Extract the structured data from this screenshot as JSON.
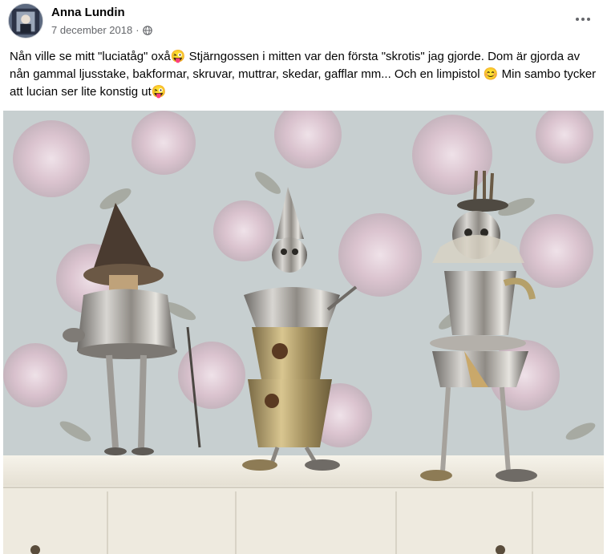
{
  "post": {
    "author": "Anna Lundin",
    "date": "7 december 2018",
    "separator": "·",
    "privacy_icon": "globe-icon",
    "more_icon": "more-options-icon",
    "text": "Nån ville se mitt \"luciatåg\" oxå😜 Stjärngossen i mitten var den första \"skrotis\" jag gjorde. Dom är gjorda av nån gammal ljusstake, bakformar, skruvar, muttrar, skedar, gafflar mm... Och en limpistol 😊 Min sambo tycker att lucian ser lite konstig ut😜"
  },
  "colors": {
    "author_text": "#050505",
    "meta_text": "#65676b",
    "wallpaper": "#c8cfd0",
    "shelf": "#f3f0e6"
  }
}
